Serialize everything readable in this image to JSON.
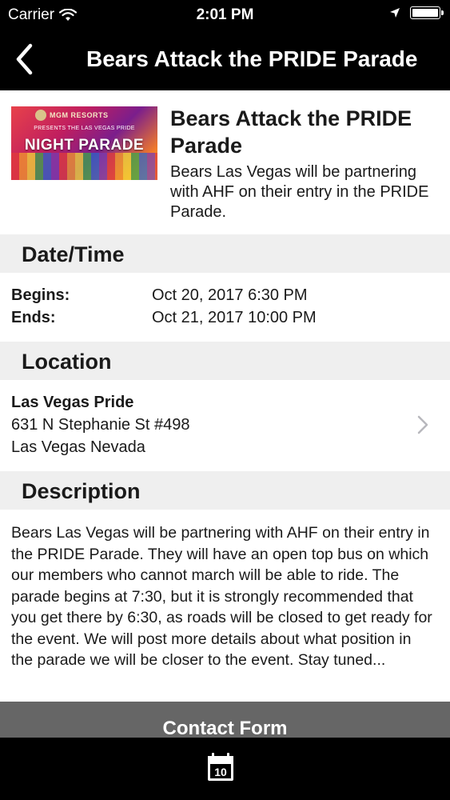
{
  "status_bar": {
    "carrier": "Carrier",
    "time": "2:01 PM"
  },
  "nav": {
    "title": "Bears Attack the PRIDE Parade"
  },
  "event": {
    "title": "Bears Attack the PRIDE Parade",
    "summary": "Bears Las Vegas will be partnering with AHF on their entry in the PRIDE Parade.",
    "thumbnail": {
      "brand": "MGM RESORTS",
      "subtitle": "PRESENTS THE LAS VEGAS PRIDE",
      "headline": "NIGHT PARADE"
    }
  },
  "date_time": {
    "header": "Date/Time",
    "begins_label": "Begins:",
    "begins_value": "Oct 20, 2017 6:30 PM",
    "ends_label": "Ends:",
    "ends_value": "Oct 21, 2017 10:00 PM"
  },
  "location": {
    "header": "Location",
    "name": "Las Vegas Pride",
    "address_line1": "631 N Stephanie St #498",
    "address_line2": "Las Vegas Nevada"
  },
  "description": {
    "header": "Description",
    "text": "Bears Las Vegas will be partnering with AHF on their entry in the PRIDE Parade. They will have an open top bus on which our members who cannot march will be able to ride. The parade begins at 7:30, but it is strongly recommended that you get there by 6:30, as roads will be closed to get ready for the event. We will post more details about what position in the parade we will be closer to the event. Stay tuned..."
  },
  "contact_button": {
    "label": "Contact Form"
  },
  "tab_bar": {
    "calendar_day": "10"
  },
  "icons": {
    "back": "chevron-left-icon",
    "wifi": "wifi-icon",
    "location_arrow": "location-arrow-icon",
    "battery": "battery-icon",
    "disclosure": "chevron-right-icon",
    "calendar": "calendar-icon"
  },
  "colors": {
    "bar_background": "#000000",
    "section_header_bg": "#efefef",
    "button_gray": "#666666",
    "text": "#1a1a1a"
  }
}
